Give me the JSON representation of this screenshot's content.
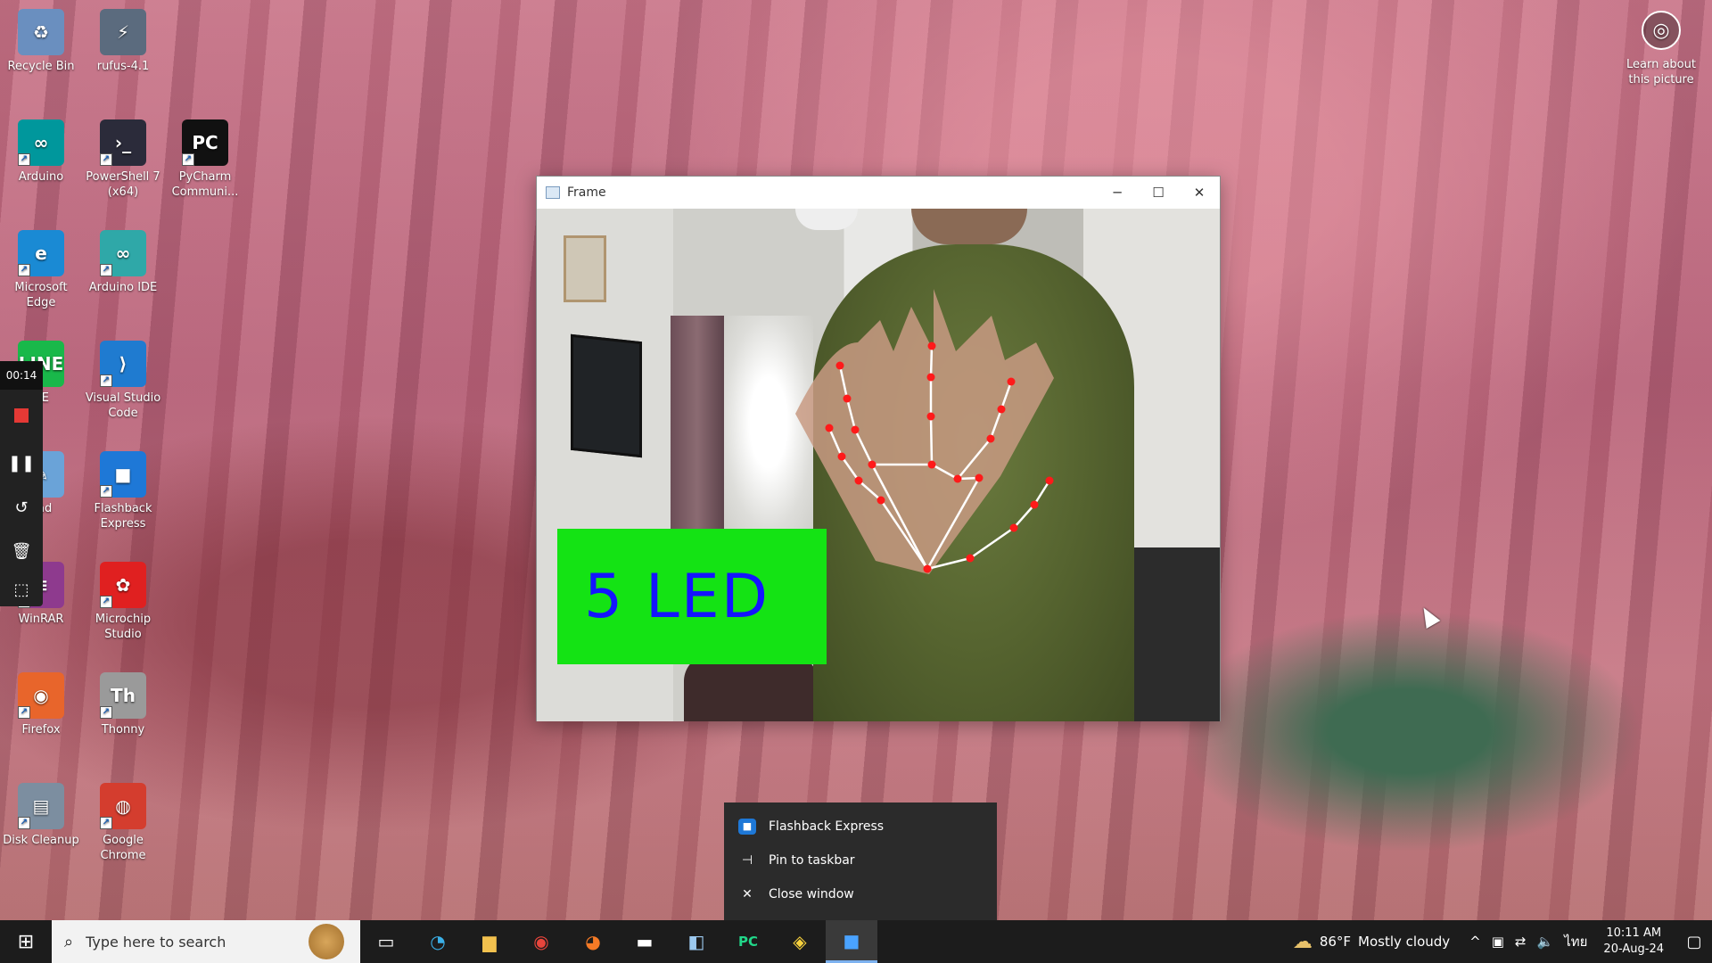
{
  "desktop": {
    "icons": [
      {
        "label": "Recycle Bin",
        "glyph": "♻",
        "color": "#6a8fbf"
      },
      {
        "label": "rufus-4.1",
        "glyph": "⚡",
        "color": "#5b6b7e"
      },
      {
        "label": "Arduino",
        "glyph": "∞",
        "color": "#00979c"
      },
      {
        "label": "PowerShell 7 (x64)",
        "glyph": "›_",
        "color": "#2b2b3a"
      },
      {
        "label": "PyCharm Communi...",
        "glyph": "PC",
        "color": "#111111"
      },
      {
        "label": "Microsoft Edge",
        "glyph": "e",
        "color": "#1a8ad4"
      },
      {
        "label": "Arduino IDE",
        "glyph": "∞",
        "color": "#2fa8a8"
      },
      {
        "label": "NE",
        "glyph": "LINE",
        "color": "#19b84a"
      },
      {
        "label": "Visual Studio Code",
        "glyph": "⟩",
        "color": "#1f7bd0"
      },
      {
        "label": "pad",
        "glyph": "✎",
        "color": "#6aa3d8"
      },
      {
        "label": "Flashback Express",
        "glyph": "■",
        "color": "#1e78d7"
      },
      {
        "label": "WinRAR",
        "glyph": "≡",
        "color": "#8e3a8e"
      },
      {
        "label": "Microchip Studio",
        "glyph": "✿",
        "color": "#e02020"
      },
      {
        "label": "Firefox",
        "glyph": "◉",
        "color": "#e8652b"
      },
      {
        "label": "Thonny",
        "glyph": "Th",
        "color": "#9a9a9a"
      },
      {
        "label": "Disk Cleanup",
        "glyph": "▤",
        "color": "#7c8ea0"
      },
      {
        "label": "Google Chrome",
        "glyph": "◍",
        "color": "#d43d2e"
      }
    ],
    "learn": {
      "label": "Learn about this picture",
      "icon": "camera-icon"
    }
  },
  "recorder": {
    "time": "00:14",
    "buttons": [
      "stop",
      "pause",
      "restart",
      "delete",
      "select-area"
    ]
  },
  "window": {
    "title": "Frame",
    "minimize": "─",
    "maximize": "☐",
    "close": "✕",
    "overlay_text": "5 LED",
    "overlay_bg": "#14e314",
    "overlay_fg": "#1414ff"
  },
  "jumplist": {
    "items": [
      {
        "label": "Flashback Express",
        "icon": "flashback-icon"
      },
      {
        "label": "Pin to taskbar",
        "icon": "pin-icon"
      },
      {
        "label": "Close window",
        "icon": "close-icon"
      }
    ]
  },
  "taskbar": {
    "search_placeholder": "Type here to search",
    "apps": [
      "task-view",
      "edge",
      "file-explorer",
      "chrome",
      "firefox",
      "terminal",
      "notepad",
      "pycharm",
      "python",
      "flashback"
    ],
    "weather": {
      "temp": "86°F",
      "desc": "Mostly cloudy"
    },
    "lang": "ไทย",
    "time": "10:11 AM",
    "date": "20-Aug-24"
  }
}
